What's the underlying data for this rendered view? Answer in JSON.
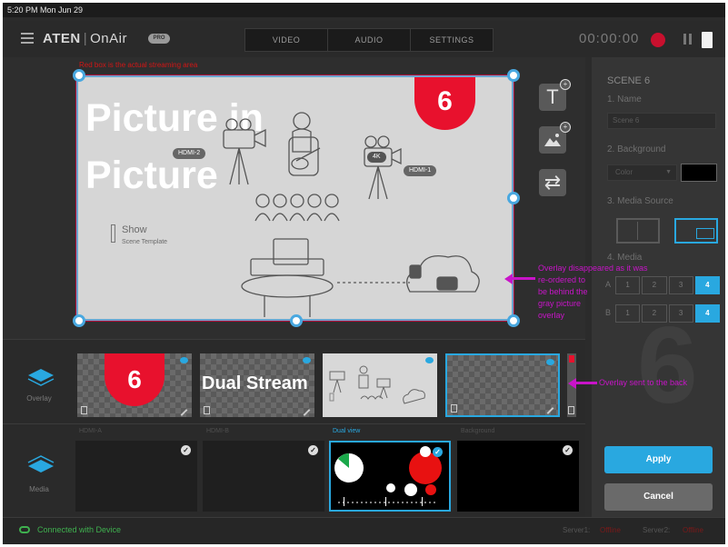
{
  "status_bar": {
    "time": "5:20 PM  Mon Jun 29"
  },
  "header": {
    "brand": "ATEN",
    "separator": "|",
    "app_name": "OnAir",
    "pro_badge": "PRO",
    "tabs": [
      {
        "label": "VIDEO"
      },
      {
        "label": "AUDIO"
      },
      {
        "label": "SETTINGS"
      }
    ],
    "timer": "00:00:00"
  },
  "preview": {
    "note": "Red box is the actual streaming area",
    "title_line1": "Picture in",
    "title_line2": "Picture",
    "badge": "6",
    "show_label": "Show",
    "show_sub": "Scene Template",
    "tag_hdmi2": "HDMI-2",
    "tag_hdmi1": "HDMI-1",
    "tag_4k": "4K"
  },
  "tools": {
    "text_icon_glyph": "T",
    "swap_glyph": "⇄"
  },
  "settings_panel": {
    "scene_title": "SCENE 6",
    "name_label": "1. Name",
    "name_value": "Scene 6",
    "background_label": "2. Background",
    "background_type": "Color",
    "background_color": "#000000",
    "media_source_label": "3. Media Source",
    "media_label": "4. Media",
    "row_a": {
      "label": "A",
      "options": [
        "1",
        "2",
        "3",
        "4"
      ],
      "selected": "4"
    },
    "row_b": {
      "label": "B",
      "options": [
        "1",
        "2",
        "3",
        "4"
      ],
      "selected": "4"
    },
    "watermark": "6",
    "apply_label": "Apply",
    "cancel_label": "Cancel"
  },
  "overlay_strip": {
    "label": "Overlay",
    "items": [
      {
        "text": "6"
      },
      {
        "text": "Dual Stream"
      },
      {
        "text": ""
      },
      {
        "text": ""
      }
    ]
  },
  "media_strip": {
    "label": "Media",
    "items": [
      {
        "label": "HDMI-A"
      },
      {
        "label": "HDMI-B"
      },
      {
        "label": "Dual view",
        "selected": true
      },
      {
        "label": "Background"
      }
    ]
  },
  "footer": {
    "connection": "Connected with Device",
    "server1_label": "Server1:",
    "server1_value": "Offline",
    "server2_label": "Server2:",
    "server2_value": "Offline"
  },
  "annotations": {
    "overlay_note": [
      "Overlay disappeared as it was",
      "re-ordered to",
      "be behind the",
      "gray picture",
      "overlay"
    ],
    "back_note": "Overlay sent to the back"
  },
  "colors": {
    "accent": "#29a8e0",
    "record": "#c8102e",
    "badge_red": "#e8112d",
    "annotation": "#c814c8",
    "connected": "#3fb04f"
  }
}
